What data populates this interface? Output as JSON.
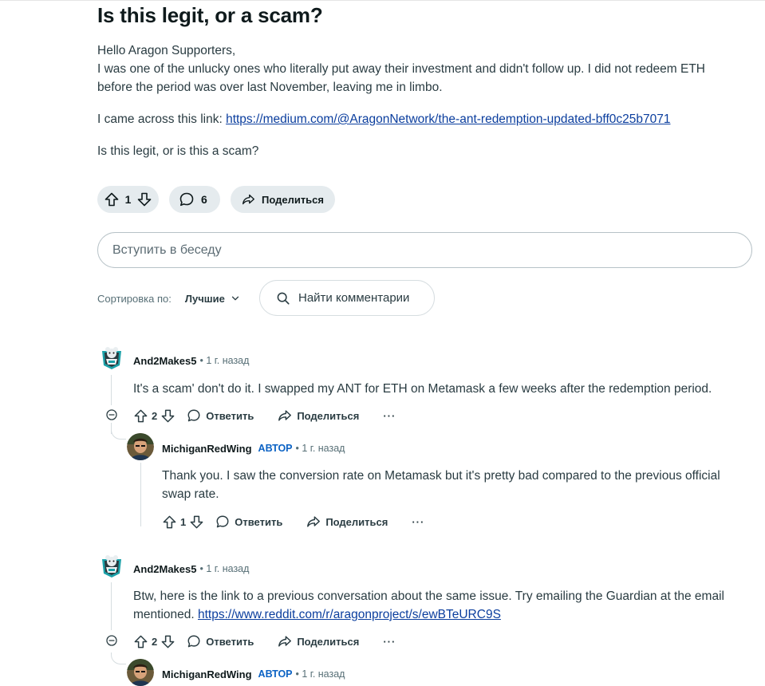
{
  "post": {
    "title": "Is this legit, or a scam?",
    "greeting": "Hello Aragon Supporters,",
    "paragraph1": "I was one of the unlucky ones who literally put away their investment and didn't follow up. I did not redeem ETH before the period was over last November, leaving me in limbo.",
    "link_prefix": "I came across this link: ",
    "link_url": "https://medium.com/@AragonNetwork/the-ant-redemption-updated-bff0c25b7071",
    "question": "Is this legit, or is this a scam?",
    "votes": "1",
    "comments": "6",
    "share_label": "Поделиться"
  },
  "join_placeholder": "Вступить в беседу",
  "sort": {
    "label": "Сортировка по:",
    "value": "Лучшие",
    "search_label": "Найти комментарии"
  },
  "actions": {
    "reply": "Ответить",
    "share": "Поделиться",
    "more": "···"
  },
  "comments": [
    {
      "author": "And2Makes5",
      "time": "• 1 г. назад",
      "text": "It's a scam' don't do it. I swapped my ANT for ETH on Metamask a few weeks after the redemption period.",
      "votes": "2",
      "reply": {
        "author": "MichiganRedWing",
        "badge": "АВТОР",
        "time": "• 1 г. назад",
        "text": "Thank you. I saw the conversion rate on Metamask but it's pretty bad compared to the previous official swap rate.",
        "votes": "1"
      }
    },
    {
      "author": "And2Makes5",
      "time": "• 1 г. назад",
      "text_prefix": "Btw, here is the link to a previous conversation about the same issue. Try emailing the Guardian at the email mentioned. ",
      "link_url": "https://www.reddit.com/r/aragonproject/s/ewBTeURC9S",
      "votes": "2",
      "reply": {
        "author": "MichiganRedWing",
        "badge": "АВТОР",
        "time": "• 1 г. назад"
      }
    }
  ],
  "colors": {
    "pill_bg": "#e5ebee",
    "link": "#0b3e9e",
    "op_badge": "#0b62c4",
    "muted_text": "#576f76"
  },
  "icons": [
    "upvote-icon",
    "downvote-icon",
    "comment-icon",
    "share-icon",
    "search-icon",
    "chevron-down-icon",
    "collapse-icon",
    "more-icon"
  ]
}
